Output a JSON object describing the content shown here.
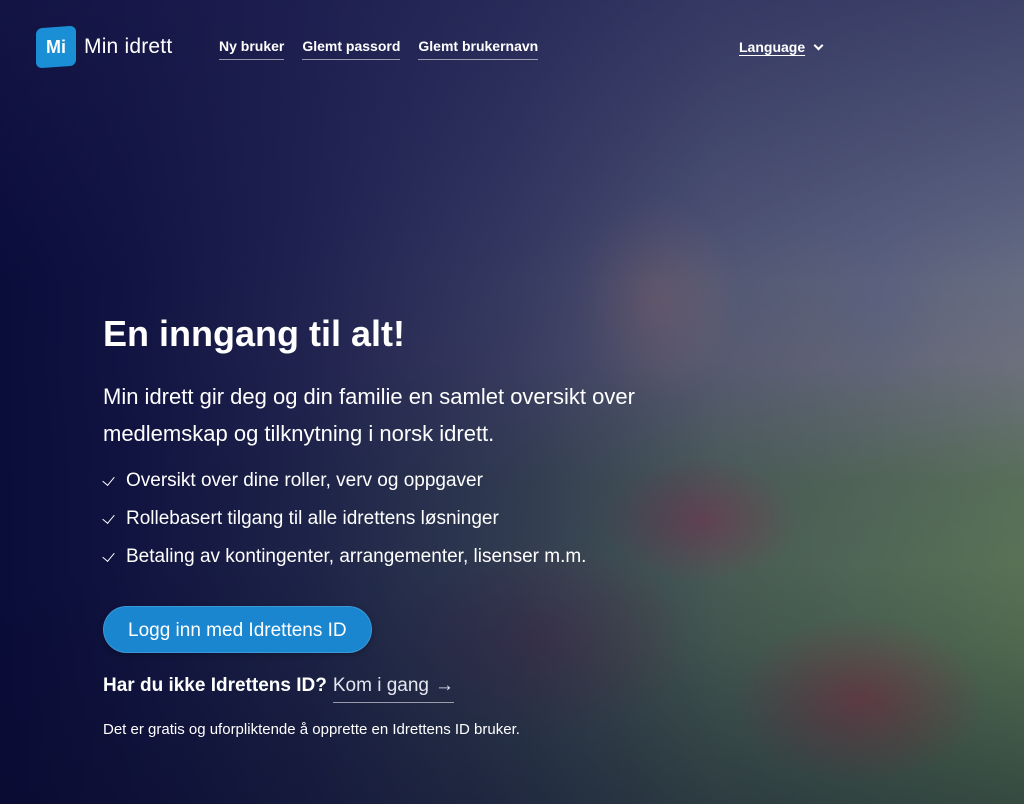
{
  "header": {
    "logo_mark": "Mi",
    "logo_text": "Min idrett",
    "nav": [
      "Ny bruker",
      "Glemt passord",
      "Glemt brukernavn"
    ],
    "language_label": "Language"
  },
  "hero": {
    "title": "En inngang til alt!",
    "lead": "Min idrett gir deg og din familie en samlet oversikt over medlemskap og tilknytning i norsk idrett.",
    "features": [
      "Oversikt over dine roller, verv og oppgaver",
      "Rollebasert tilgang til alle idrettens løsninger",
      "Betaling av kontingenter, arrangementer, lisenser m.m."
    ],
    "login_button": "Logg inn med Idrettens ID",
    "signup_question": "Har du ikke Idrettens ID?",
    "signup_link": "Kom i gang",
    "signup_arrow": "→",
    "note": "Det er gratis og uforpliktende å opprette en Idrettens ID bruker."
  },
  "colors": {
    "brand_blue": "#1a8fd6",
    "button_blue": "#1a86d0",
    "overlay_navy": "#0c0f3a"
  },
  "icons": [
    "logo-mark-icon",
    "chevron-down-icon",
    "checkmark-icon",
    "arrow-right-icon"
  ]
}
